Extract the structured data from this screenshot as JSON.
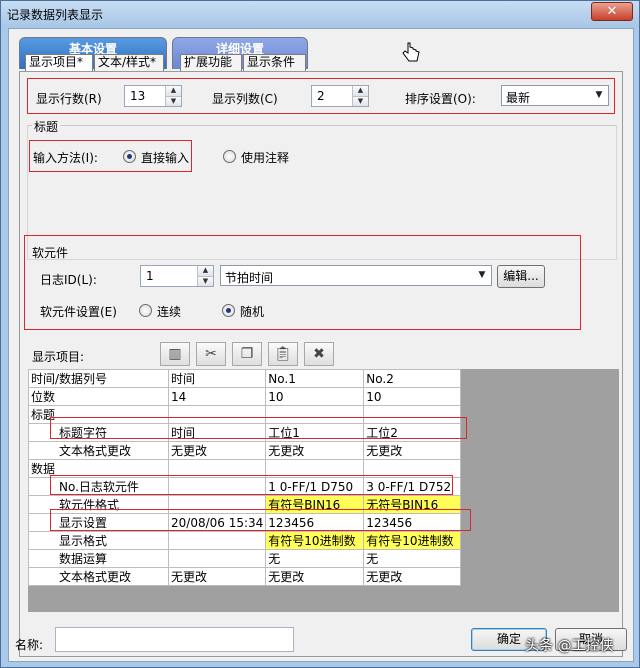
{
  "window": {
    "title": "记录数据列表显示",
    "close_glyph": "✕"
  },
  "tabs": {
    "basic": "基本设置",
    "detail": "详细设置",
    "sub": [
      "显示项目*",
      "文本/样式*",
      "扩展功能",
      "显示条件"
    ]
  },
  "display": {
    "rows_label": "显示行数(R)",
    "rows_value": "13",
    "cols_label": "显示列数(C)",
    "cols_value": "2",
    "sort_label": "排序设置(O):",
    "sort_value": "最新"
  },
  "title_group": {
    "caption": "标题",
    "input_label": "输入方法(I):",
    "opt_direct": "直接输入",
    "opt_comment": "使用注释"
  },
  "device_group": {
    "caption": "软元件",
    "log_label": "日志ID(L):",
    "log_value": "1",
    "log_combo": "节拍时间",
    "edit_button": "编辑...",
    "setting_label": "软元件设置(E)",
    "opt_continuous": "连续",
    "opt_random": "随机"
  },
  "items": {
    "label": "显示项目:",
    "toolbar_icons": [
      "insert-column-icon",
      "cut-icon",
      "copy-icon",
      "paste-icon",
      "delete-icon"
    ]
  },
  "grid": {
    "rows": [
      [
        "时间/数据列号",
        "时间",
        "No.1",
        "No.2"
      ],
      [
        "位数",
        "14",
        "10",
        "10"
      ],
      [
        "标题",
        "",
        "",
        ""
      ],
      [
        "标题字符",
        "时间",
        "工位1",
        "工位2"
      ],
      [
        "文本格式更改",
        "无更改",
        "无更改",
        "无更改"
      ],
      [
        "数据",
        "",
        "",
        ""
      ],
      [
        "No.日志软元件",
        "",
        "1 0-FF/1 D750",
        "3 0-FF/1 D752"
      ],
      [
        "软元件格式",
        "",
        "有符号BIN16",
        "无符号BIN16"
      ],
      [
        "显示设置",
        "20/08/06 15:34",
        "123456",
        "123456"
      ],
      [
        "显示格式",
        "",
        "有符号10进制数",
        "有符号10进制数"
      ],
      [
        "数据运算",
        "",
        "无",
        "无"
      ],
      [
        "文本格式更改",
        "无更改",
        "无更改",
        "无更改"
      ]
    ]
  },
  "footer": {
    "name_label": "名称:",
    "ok": "确定",
    "cancel": "取消",
    "watermark": "头条 @工控侠"
  }
}
